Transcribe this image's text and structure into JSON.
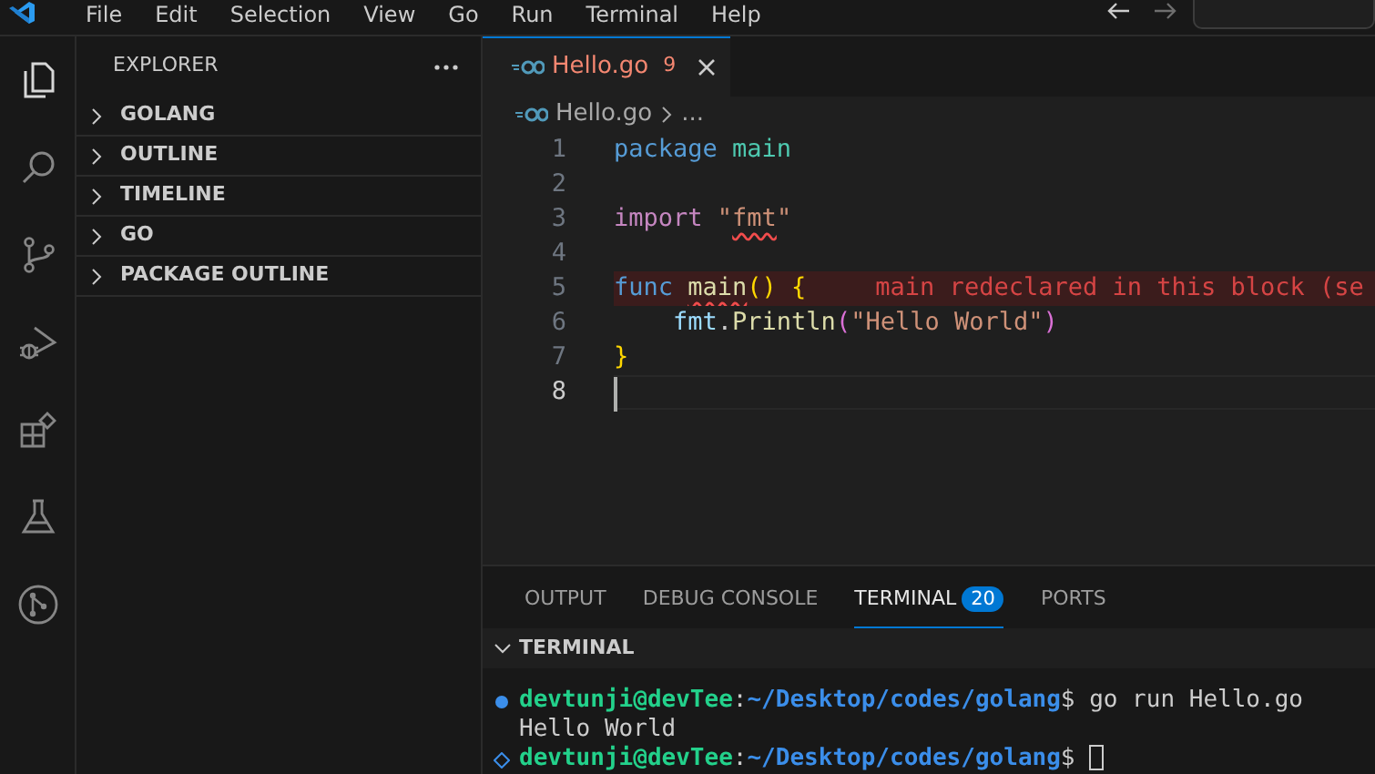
{
  "menu": [
    "File",
    "Edit",
    "Selection",
    "View",
    "Go",
    "Run",
    "Terminal",
    "Help"
  ],
  "activity_bar": [
    {
      "kind": "files",
      "selected": true
    },
    {
      "kind": "search",
      "selected": false
    },
    {
      "kind": "source-control",
      "selected": false
    },
    {
      "kind": "run-debug",
      "selected": false
    },
    {
      "kind": "extensions",
      "selected": false
    },
    {
      "kind": "testing",
      "selected": false
    },
    {
      "kind": "git-graph",
      "selected": false
    }
  ],
  "sidebar": {
    "title": "EXPLORER",
    "sections": [
      {
        "label": "GOLANG",
        "expanded": false
      },
      {
        "label": "OUTLINE",
        "expanded": false
      },
      {
        "label": "TIMELINE",
        "expanded": false
      },
      {
        "label": "GO",
        "expanded": false
      },
      {
        "label": "PACKAGE OUTLINE",
        "expanded": false
      }
    ]
  },
  "tabs": [
    {
      "label": "Hello.go",
      "badge": "9",
      "selected": true,
      "has_errors": true
    }
  ],
  "breadcrumb": [
    "Hello.go",
    "..."
  ],
  "code_lines": [
    {
      "number": "1",
      "tokens": [
        {
          "kind": "keyword",
          "text": "package"
        },
        {
          "kind": "type",
          "text": "main",
          "space_before": true
        }
      ]
    },
    {
      "number": "2"
    },
    {
      "number": "3",
      "tokens": [
        {
          "kind": "control",
          "text": "import"
        },
        {
          "kind": "string",
          "text": "\"",
          "space_before": true
        },
        {
          "kind": "string",
          "text": "fmt",
          "squiggle": true
        },
        {
          "kind": "string",
          "text": "\""
        }
      ]
    },
    {
      "number": "4"
    },
    {
      "number": "5",
      "error_message": "main redeclared in this block (se",
      "tokens": [
        {
          "kind": "keyword",
          "text": "func"
        },
        {
          "kind": "function",
          "text": "main",
          "squiggle": true,
          "space_before": true
        },
        {
          "kind": "bracket",
          "text": "() {"
        }
      ]
    },
    {
      "number": "6",
      "indented": true,
      "tokens": [
        {
          "kind": "variable",
          "text": "fmt"
        },
        {
          "kind": "plain",
          "text": "."
        },
        {
          "kind": "function",
          "text": "Println"
        },
        {
          "kind": "bracket2",
          "text": "("
        },
        {
          "kind": "string",
          "text": "\"Hello World\""
        },
        {
          "kind": "bracket2",
          "text": ")"
        }
      ]
    },
    {
      "number": "7",
      "tokens": [
        {
          "kind": "bracket",
          "text": "}"
        }
      ]
    },
    {
      "number": "8",
      "current": true
    }
  ],
  "panel_tabs": [
    {
      "label": "OUTPUT",
      "selected": false
    },
    {
      "label": "DEBUG CONSOLE",
      "selected": false
    },
    {
      "label": "TERMINAL",
      "badge": "20",
      "selected": true
    },
    {
      "label": "PORTS",
      "selected": false
    }
  ],
  "terminal_section": {
    "label": "TERMINAL",
    "expanded": true
  },
  "terminal_lines": [
    {
      "decorated": true,
      "succeeded": true,
      "segments": [
        {
          "kind": "user",
          "text": "devtunji@devTee"
        },
        {
          "kind": "plain",
          "text": ":"
        },
        {
          "kind": "path",
          "text": "~/Desktop/codes/golang"
        },
        {
          "kind": "plain",
          "text": "$ go run Hello.go"
        }
      ]
    },
    {
      "segments": [
        {
          "kind": "plain",
          "text": "Hello World"
        }
      ]
    },
    {
      "decorated": true,
      "succeeded": false,
      "cursor": true,
      "segments": [
        {
          "kind": "user",
          "text": "devtunji@devTee"
        },
        {
          "kind": "plain",
          "text": ":"
        },
        {
          "kind": "path",
          "text": "~/Desktop/codes/golang"
        },
        {
          "kind": "plain",
          "text": "$"
        }
      ]
    }
  ]
}
